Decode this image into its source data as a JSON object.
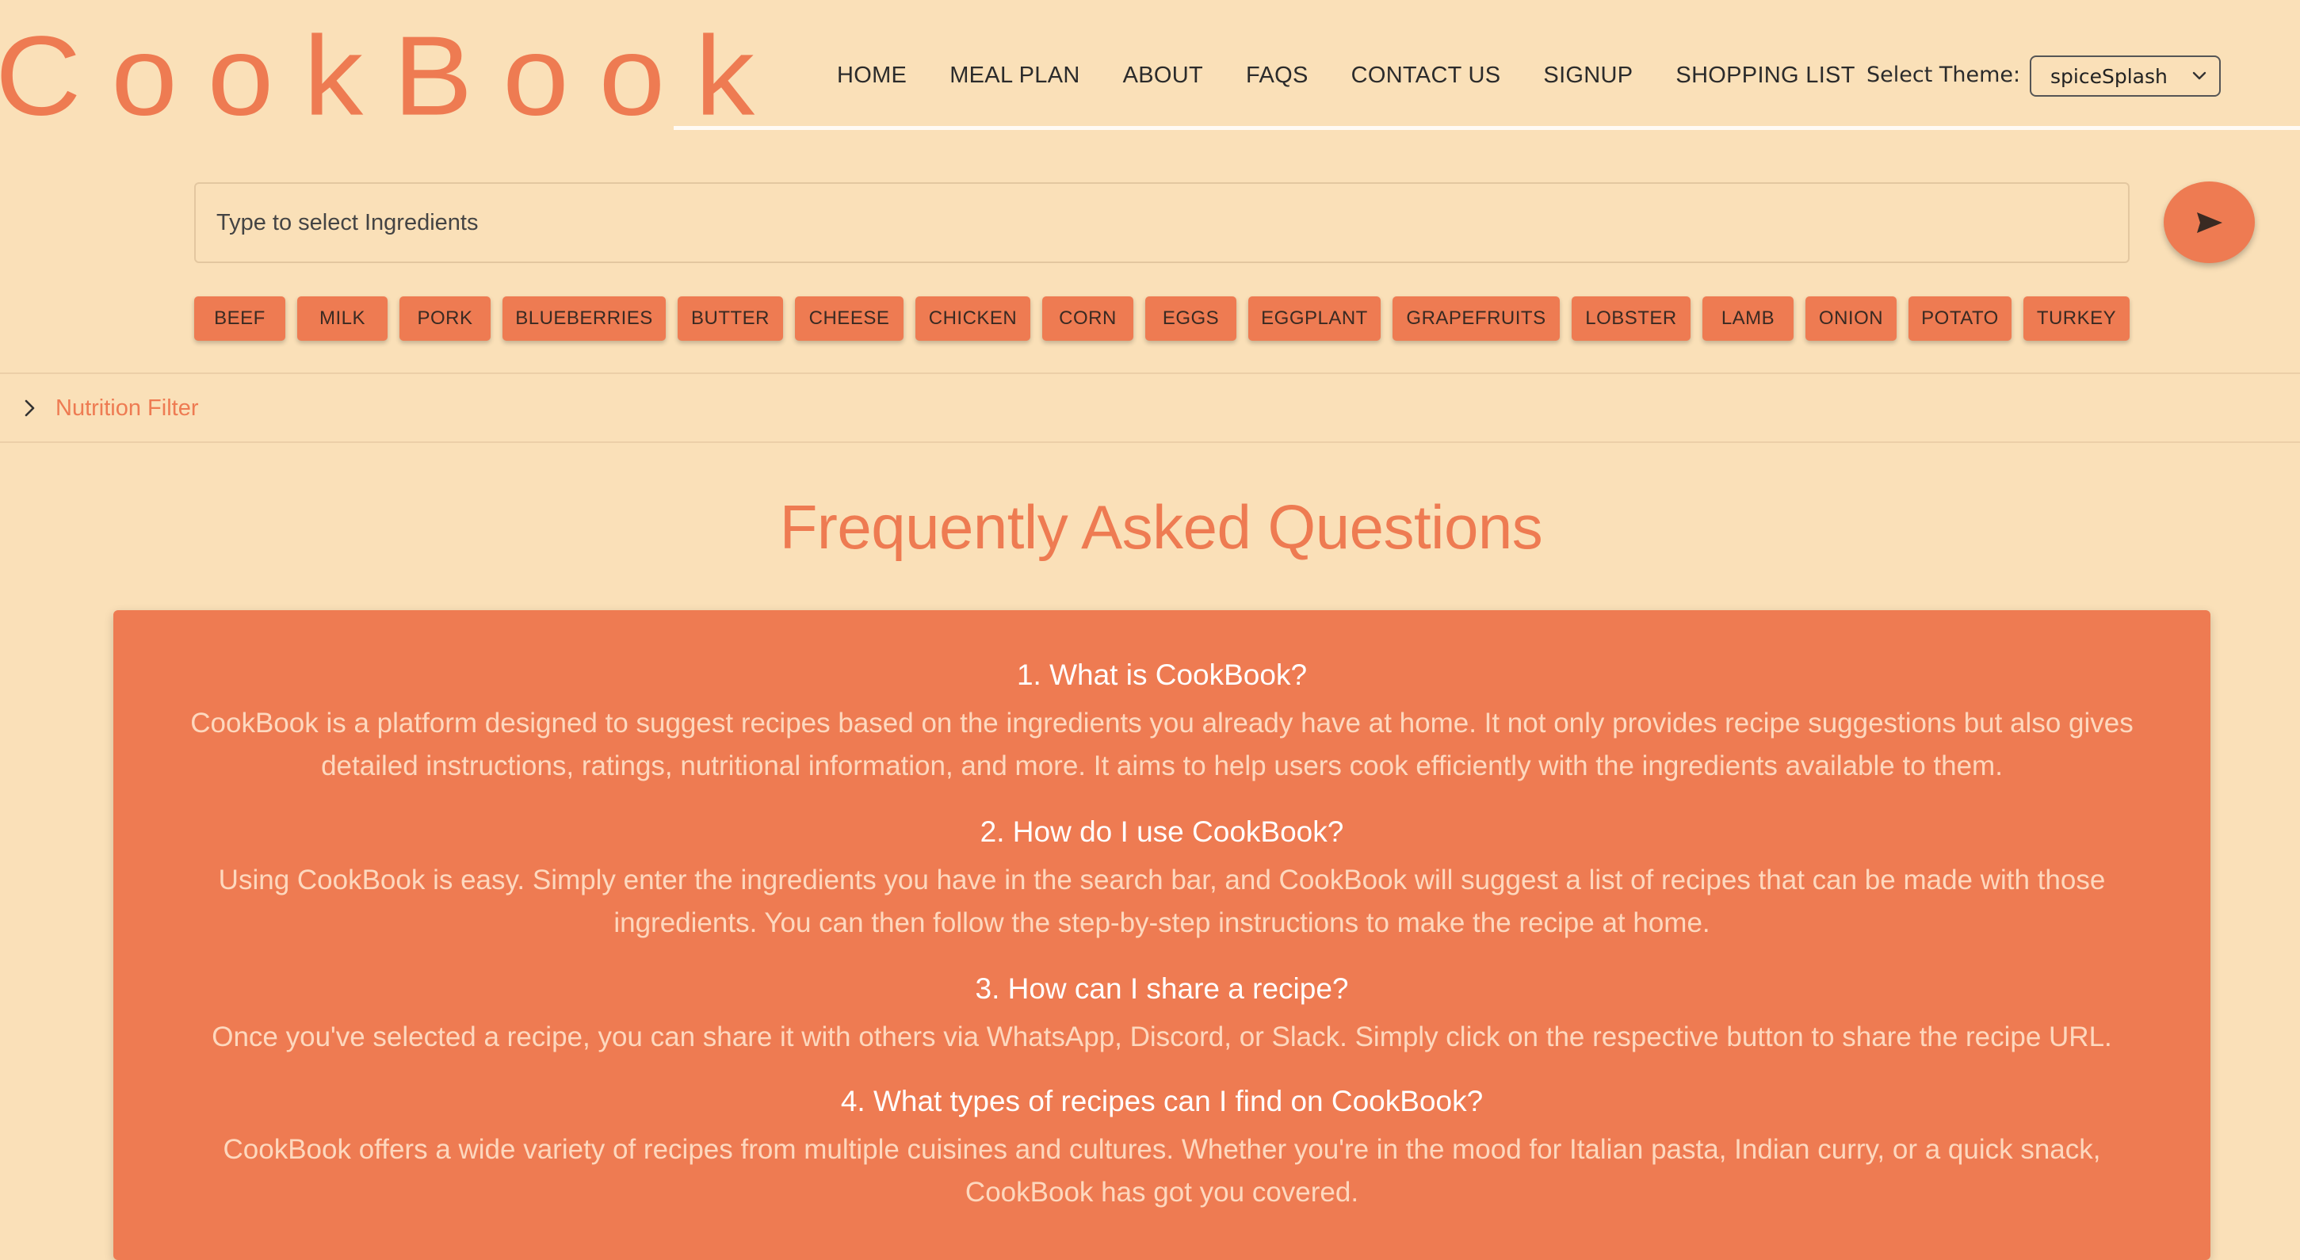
{
  "header": {
    "logo": "CookBook",
    "nav": [
      "HOME",
      "MEAL PLAN",
      "ABOUT",
      "FAQS",
      "CONTACT US",
      "SIGNUP",
      "SHOPPING LIST"
    ],
    "theme_label": "Select Theme:",
    "theme_value": "spiceSplash"
  },
  "search": {
    "placeholder": "Type to select Ingredients",
    "send_icon": "send-icon"
  },
  "ingredients": [
    "BEEF",
    "MILK",
    "PORK",
    "BLUEBERRIES",
    "BUTTER",
    "CHEESE",
    "CHICKEN",
    "CORN",
    "EGGS",
    "EGGPLANT",
    "GRAPEFRUITS",
    "LOBSTER",
    "LAMB",
    "ONION",
    "POTATO",
    "TURKEY"
  ],
  "nutrition_filter": {
    "label": "Nutrition Filter",
    "icon": "chevron-right-icon"
  },
  "faq": {
    "title": "Frequently Asked Questions",
    "items": [
      {
        "q": "1. What is CookBook?",
        "a": "CookBook is a platform designed to suggest recipes based on the ingredients you already have at home. It not only provides recipe suggestions but also gives detailed instructions, ratings, nutritional information, and more. It aims to help users cook efficiently with the ingredients available to them."
      },
      {
        "q": "2. How do I use CookBook?",
        "a": "Using CookBook is easy. Simply enter the ingredients you have in the search bar, and CookBook will suggest a list of recipes that can be made with those ingredients. You can then follow the step-by-step instructions to make the recipe at home."
      },
      {
        "q": "3. How can I share a recipe?",
        "a": "Once you've selected a recipe, you can share it with others via WhatsApp, Discord, or Slack. Simply click on the respective button to share the recipe URL."
      },
      {
        "q": "4. What types of recipes can I find on CookBook?",
        "a": "CookBook offers a wide variety of recipes from multiple cuisines and cultures. Whether you're in the mood for Italian pasta, Indian curry, or a quick snack, CookBook has got you covered."
      }
    ]
  },
  "colors": {
    "background": "#fae0b8",
    "accent": "#ee7b52",
    "nav_text": "#2b2b2b"
  }
}
